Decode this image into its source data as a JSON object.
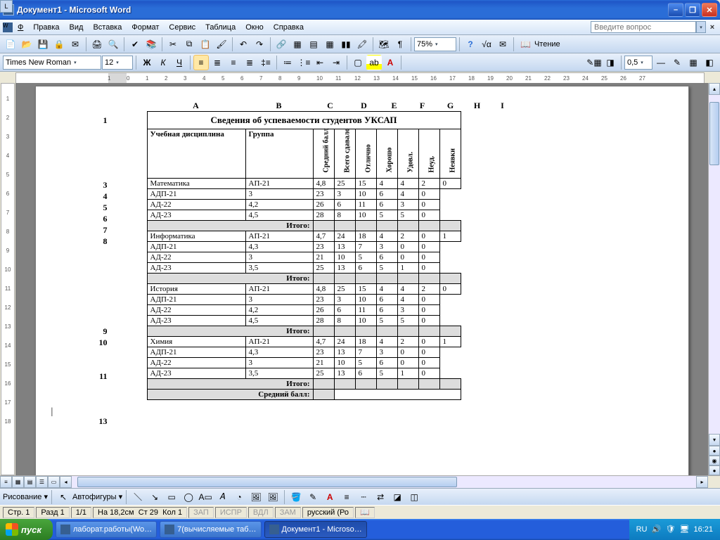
{
  "window": {
    "title": "Документ1 - Microsoft Word"
  },
  "menu": {
    "file": "Файл",
    "edit": "Правка",
    "view": "Вид",
    "insert": "Вставка",
    "format": "Формат",
    "tools": "Сервис",
    "table": "Таблица",
    "window": "Окно",
    "help": "Справка",
    "ask_placeholder": "Введите вопрос"
  },
  "toolbar": {
    "font_name": "Times New Roman",
    "font_size": "12",
    "zoom": "75%",
    "reading": "Чтение",
    "line_weight": "0,5"
  },
  "drawing": {
    "label": "Рисование",
    "autoshapes": "Автофигуры"
  },
  "status": {
    "page_lbl": "Стр.",
    "page": "1",
    "sect_lbl": "Разд",
    "sect": "1",
    "pages": "1/1",
    "at_lbl": "На",
    "at": "18,2см",
    "line_lbl": "Ст",
    "line": "29",
    "col_lbl": "Кол",
    "col": "1",
    "rec": "ЗАП",
    "trk": "ИСПР",
    "ext": "ВДЛ",
    "ovr": "ЗАМ",
    "lang": "русский (Ро"
  },
  "taskbar": {
    "start": "пуск",
    "items": [
      {
        "label": "лаборат.работы(Wo…"
      },
      {
        "label": "7(вычисляемые таб…"
      },
      {
        "label": "Документ1 - Microso…"
      }
    ],
    "lang": "RU",
    "clock": "16:21"
  },
  "chart_data": {
    "type": "table",
    "title": "Сведения об успеваемости студентов УКСАП",
    "column_letters": [
      "A",
      "B",
      "C",
      "D",
      "E",
      "F",
      "G",
      "H",
      "I"
    ],
    "row_numbers": [
      "1",
      "",
      "3",
      "4",
      "5",
      "6",
      "7",
      "8",
      "",
      "",
      "",
      "",
      "",
      "",
      "",
      "9",
      "10",
      "",
      "",
      "11",
      "",
      "",
      "",
      "13"
    ],
    "headers": {
      "discipline": "Учебная дисциплина",
      "group": "Группа",
      "avg": "Средний балл",
      "total": "Всего сдавало",
      "excellent": "Отлично",
      "good": "Хорошо",
      "satisf": "Удовл.",
      "unsat": "Неуд.",
      "absent": "Неявки"
    },
    "subtotal_label": "Итого:",
    "grand_avg_label": "Средний балл:",
    "sections": [
      {
        "discipline": "Математика",
        "rows": [
          {
            "group": "АП-21",
            "avg": "4,8",
            "total": "25",
            "exc": "15",
            "good": "4",
            "sat": "4",
            "unsat": "2",
            "abs": "0"
          },
          {
            "group": "АДП-21",
            "avg": "3",
            "total": "23",
            "exc": "3",
            "good": "10",
            "sat": "6",
            "unsat": "4",
            "abs": "0"
          },
          {
            "group": "АД-22",
            "avg": "4,2",
            "total": "26",
            "exc": "6",
            "good": "11",
            "sat": "6",
            "unsat": "3",
            "abs": "0"
          },
          {
            "group": "АД-23",
            "avg": "4,5",
            "total": "28",
            "exc": "8",
            "good": "10",
            "sat": "5",
            "unsat": "5",
            "abs": "0"
          }
        ]
      },
      {
        "discipline": "Информатика",
        "rows": [
          {
            "group": "АП-21",
            "avg": "4,7",
            "total": "24",
            "exc": "18",
            "good": "4",
            "sat": "2",
            "unsat": "0",
            "abs": "1"
          },
          {
            "group": "АДП-21",
            "avg": "4,3",
            "total": "23",
            "exc": "13",
            "good": "7",
            "sat": "3",
            "unsat": "0",
            "abs": "0"
          },
          {
            "group": "АД-22",
            "avg": "3",
            "total": "21",
            "exc": "10",
            "good": "5",
            "sat": "6",
            "unsat": "0",
            "abs": "0"
          },
          {
            "group": "АД-23",
            "avg": "3,5",
            "total": "25",
            "exc": "13",
            "good": "6",
            "sat": "5",
            "unsat": "1",
            "abs": "0"
          }
        ]
      },
      {
        "discipline": "История",
        "rows": [
          {
            "group": "АП-21",
            "avg": "4,8",
            "total": "25",
            "exc": "15",
            "good": "4",
            "sat": "4",
            "unsat": "2",
            "abs": "0"
          },
          {
            "group": "АДП-21",
            "avg": "3",
            "total": "23",
            "exc": "3",
            "good": "10",
            "sat": "6",
            "unsat": "4",
            "abs": "0"
          },
          {
            "group": "АД-22",
            "avg": "4,2",
            "total": "26",
            "exc": "6",
            "good": "11",
            "sat": "6",
            "unsat": "3",
            "abs": "0"
          },
          {
            "group": "АД-23",
            "avg": "4,5",
            "total": "28",
            "exc": "8",
            "good": "10",
            "sat": "5",
            "unsat": "5",
            "abs": "0"
          }
        ]
      },
      {
        "discipline": "Химия",
        "rows": [
          {
            "group": "АП-21",
            "avg": "4,7",
            "total": "24",
            "exc": "18",
            "good": "4",
            "sat": "2",
            "unsat": "0",
            "abs": "1"
          },
          {
            "group": "АДП-21",
            "avg": "4,3",
            "total": "23",
            "exc": "13",
            "good": "7",
            "sat": "3",
            "unsat": "0",
            "abs": "0"
          },
          {
            "group": "АД-22",
            "avg": "3",
            "total": "21",
            "exc": "10",
            "good": "5",
            "sat": "6",
            "unsat": "0",
            "abs": "0"
          },
          {
            "group": "АД-23",
            "avg": "3,5",
            "total": "25",
            "exc": "13",
            "good": "6",
            "sat": "5",
            "unsat": "1",
            "abs": "0"
          }
        ]
      }
    ]
  }
}
